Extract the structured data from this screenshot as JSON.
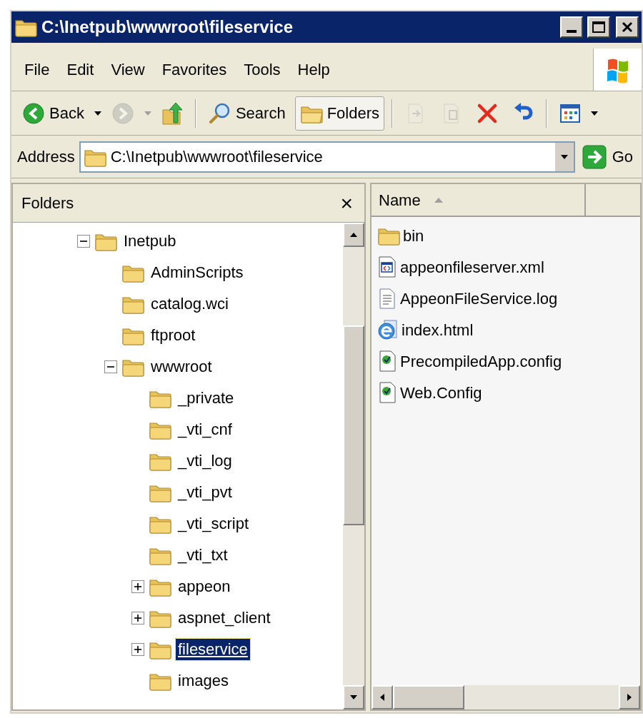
{
  "window": {
    "title": "C:\\Inetpub\\wwwroot\\fileservice"
  },
  "menu": [
    "File",
    "Edit",
    "View",
    "Favorites",
    "Tools",
    "Help"
  ],
  "toolbar": [
    {
      "kind": "back",
      "label": "Back",
      "disabled": false,
      "pressed": false
    },
    {
      "kind": "forward",
      "disabled": true,
      "pressed": false
    },
    {
      "kind": "up",
      "disabled": false,
      "pressed": false
    },
    {
      "kind": "search",
      "label": "Search",
      "disabled": false,
      "pressed": false
    },
    {
      "kind": "folders",
      "label": "Folders",
      "disabled": false,
      "pressed": true
    },
    {
      "kind": "move",
      "disabled": true,
      "pressed": false
    },
    {
      "kind": "copy",
      "disabled": true,
      "pressed": false
    },
    {
      "kind": "delete",
      "disabled": false,
      "pressed": false
    },
    {
      "kind": "undo",
      "disabled": false,
      "pressed": false
    },
    {
      "kind": "views",
      "disabled": false,
      "pressed": false
    }
  ],
  "address": {
    "label": "Address",
    "value": "C:\\Inetpub\\wwwroot\\fileservice",
    "go": "Go"
  },
  "folders_pane": {
    "title": "Folders",
    "close": "×"
  },
  "tree": [
    {
      "label": "Inetpub",
      "expanded": true,
      "selected": false,
      "children": [
        {
          "label": "AdminScripts",
          "selected": false
        },
        {
          "label": "catalog.wci",
          "selected": false
        },
        {
          "label": "ftproot",
          "selected": false
        },
        {
          "label": "wwwroot",
          "expanded": true,
          "selected": false,
          "children": [
            {
              "label": "_private",
              "selected": false
            },
            {
              "label": "_vti_cnf",
              "selected": false
            },
            {
              "label": "_vti_log",
              "selected": false
            },
            {
              "label": "_vti_pvt",
              "selected": false
            },
            {
              "label": "_vti_script",
              "selected": false
            },
            {
              "label": "_vti_txt",
              "selected": false
            },
            {
              "label": "appeon",
              "expanded": false,
              "selected": false
            },
            {
              "label": "aspnet_client",
              "expanded": false,
              "selected": false
            },
            {
              "label": "fileservice",
              "expanded": false,
              "selected": true
            },
            {
              "label": "images",
              "selected": false
            }
          ]
        }
      ]
    }
  ],
  "columns": [
    {
      "label": "Name",
      "sorted": true
    }
  ],
  "files": [
    {
      "name": "bin",
      "kind": "folder"
    },
    {
      "name": "appeonfileserver.xml",
      "kind": "xml"
    },
    {
      "name": "AppeonFileService.log",
      "kind": "log"
    },
    {
      "name": "index.html",
      "kind": "html"
    },
    {
      "name": "PrecompiledApp.config",
      "kind": "config"
    },
    {
      "name": "Web.Config",
      "kind": "config"
    }
  ]
}
